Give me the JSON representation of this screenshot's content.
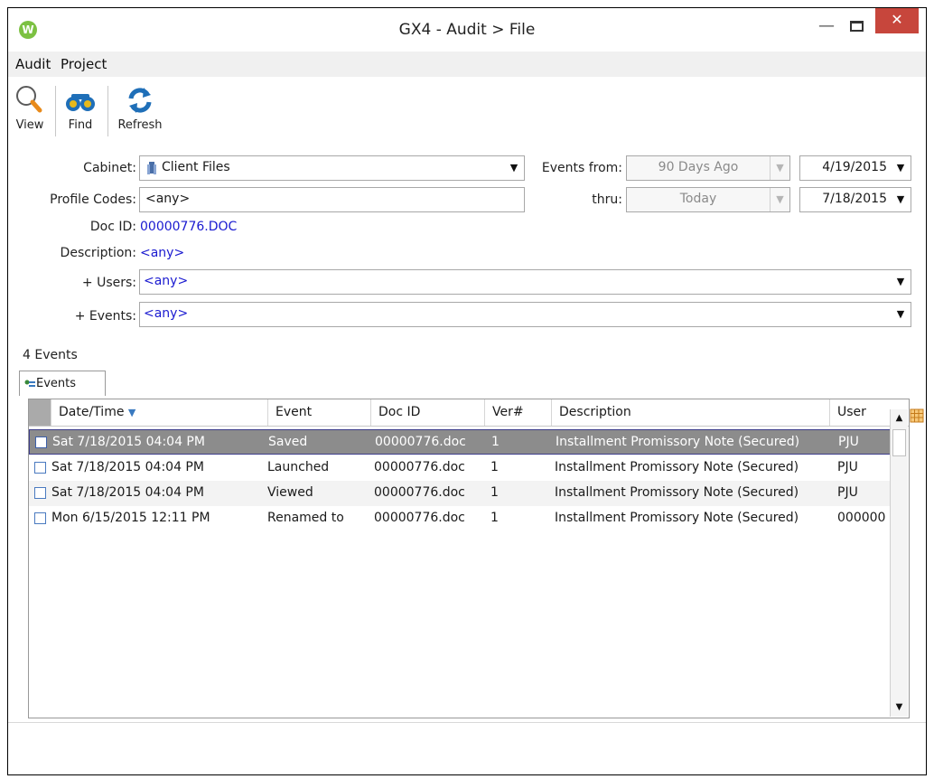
{
  "window": {
    "title": "GX4 - Audit > File",
    "app_icon_letter": "W",
    "minimize": "—",
    "close": "✕"
  },
  "menu": {
    "items": [
      "Audit",
      "Project"
    ]
  },
  "toolbar": {
    "view_label": "View",
    "find_label": "Find",
    "refresh_label": "Refresh"
  },
  "filters": {
    "cabinet_label": "Cabinet:",
    "cabinet_value": "Client Files",
    "profile_codes_label": "Profile Codes:",
    "profile_codes_value": "<any>",
    "doc_id_label": "Doc ID:",
    "doc_id_value": "00000776.DOC",
    "description_label": "Description:",
    "description_value": "<any>",
    "users_label": "+ Users:",
    "users_value": "<any>",
    "events_label": "+ Events:",
    "events_value": "<any>",
    "events_from_label": "Events from:",
    "events_from_preset": "90 Days Ago",
    "events_from_date": "4/19/2015",
    "thru_label": "thru:",
    "thru_preset": "Today",
    "thru_date": "7/18/2015"
  },
  "summary": {
    "count": "4",
    "count_suffix": "Events"
  },
  "tabs": [
    {
      "label": "Events"
    }
  ],
  "grid": {
    "columns": [
      "Date/Time",
      "Event",
      "Doc ID",
      "Ver#",
      "Description",
      "User"
    ],
    "sort_indicator": "▼",
    "rows": [
      {
        "datetime": "Sat 7/18/2015 04:04 PM",
        "event": "Saved",
        "doc_id": "00000776.doc",
        "ver": "1",
        "description": "Installment Promissory Note (Secured)",
        "user": "PJU"
      },
      {
        "datetime": "Sat 7/18/2015 04:04 PM",
        "event": "Launched",
        "doc_id": "00000776.doc",
        "ver": "1",
        "description": "Installment Promissory Note (Secured)",
        "user": "PJU"
      },
      {
        "datetime": "Sat 7/18/2015 04:04 PM",
        "event": "Viewed",
        "doc_id": "00000776.doc",
        "ver": "1",
        "description": "Installment Promissory Note (Secured)",
        "user": "PJU"
      },
      {
        "datetime": "Mon 6/15/2015 12:11 PM",
        "event": "Renamed to",
        "doc_id": "00000776.doc",
        "ver": "1",
        "description": "Installment Promissory Note (Secured)",
        "user": "000000"
      }
    ]
  },
  "colors": {
    "link_blue": "#1a1ad0",
    "close_red": "#c7463c",
    "selected_row": "#8c8c8c",
    "icon_blue": "#1f6fb8",
    "magnifier_handle": "#e88a1a"
  },
  "icons": {
    "view": "magnifier-icon",
    "find": "binoculars-icon",
    "refresh": "refresh-icon",
    "cabinet": "cabinet-icon",
    "grid_settings": "grid-settings-icon"
  }
}
